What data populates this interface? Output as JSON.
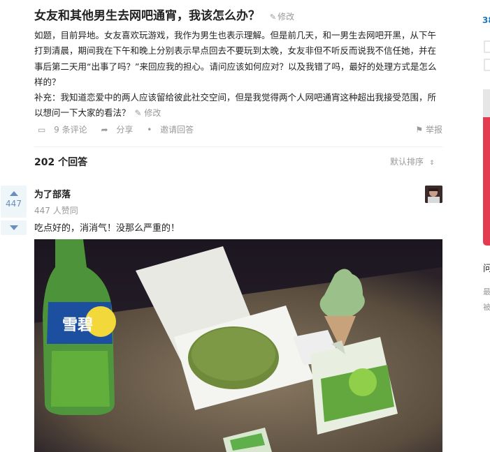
{
  "question": {
    "title": "女友和其他男生去网吧通宵，我该怎么办？",
    "edit_label": "修改",
    "body": "如题，目前异地。女友喜欢玩游戏，我作为男生也表示理解。但是前几天，和一男生去网吧开黑，从下午打到清晨，期间我在下午和晚上分别表示早点回去不要玩到太晚，女友非但不听反而说我不信任她，并在事后第二天用“出事了吗？”来回应我的担心。请问应该如何应对？以及我错了吗，最好的处理方式是怎么样的？",
    "supplement": "补充：我知道恋爱中的两人应该留给彼此社交空间，但是我觉得两个人网吧通宵这种超出我接受范围，所以想问一下大家的看法？",
    "supplement_edit_label": "修改",
    "comments_label": "9 条评论",
    "share_label": "分享",
    "invite_label": "邀请回答",
    "report_label": "举报"
  },
  "answers_header": {
    "count_label": "202 个回答",
    "sort_label": "默认排序"
  },
  "answer": {
    "vote_count": "447",
    "author": "为了部落",
    "votes_meta": "447 人赞同",
    "text": "吃点好的，消消气！没那么严重的！"
  },
  "sidebar": {
    "number": "38",
    "heading": "问",
    "line1": "最",
    "line2": "被"
  },
  "colors": {
    "accent": "#698ebf",
    "link": "#1e78c2",
    "muted": "#999999",
    "side_card": "#e33b50"
  },
  "icons": [
    "pencil-icon",
    "comment-icon",
    "share-icon",
    "flag-icon",
    "upvote-arrow-icon",
    "downvote-arrow-icon",
    "sort-caret-icon"
  ]
}
